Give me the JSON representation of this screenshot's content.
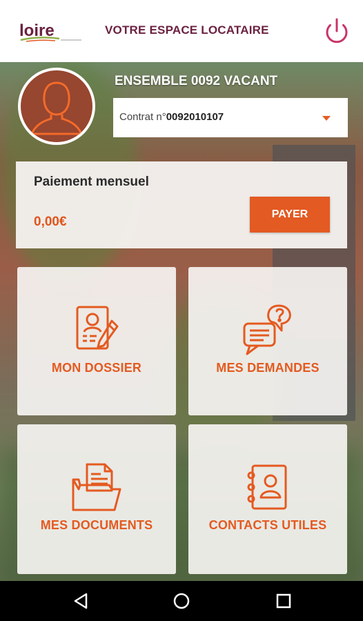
{
  "header": {
    "logo_text": "loire",
    "title": "VOTRE ESPACE LOCATAIRE",
    "power_icon": "power-icon"
  },
  "account": {
    "ensemble": "ENSEMBLE 0092 VACANT",
    "contract_prefix": "Contrat n°",
    "contract_number": "0092010107"
  },
  "payment": {
    "title": "Paiement mensuel",
    "amount": "0,00€",
    "pay_label": "PAYER"
  },
  "tiles": [
    {
      "label": "MON DOSSIER",
      "icon": "dossier-icon"
    },
    {
      "label": "MES DEMANDES",
      "icon": "demandes-icon"
    },
    {
      "label": "MES DOCUMENTS",
      "icon": "documents-icon"
    },
    {
      "label": "CONTACTS UTILES",
      "icon": "contacts-icon"
    }
  ],
  "colors": {
    "accent": "#E35A22",
    "brand": "#6B2140",
    "white": "#FFFFFF"
  },
  "nav": [
    "back-icon",
    "home-icon",
    "recents-icon"
  ]
}
